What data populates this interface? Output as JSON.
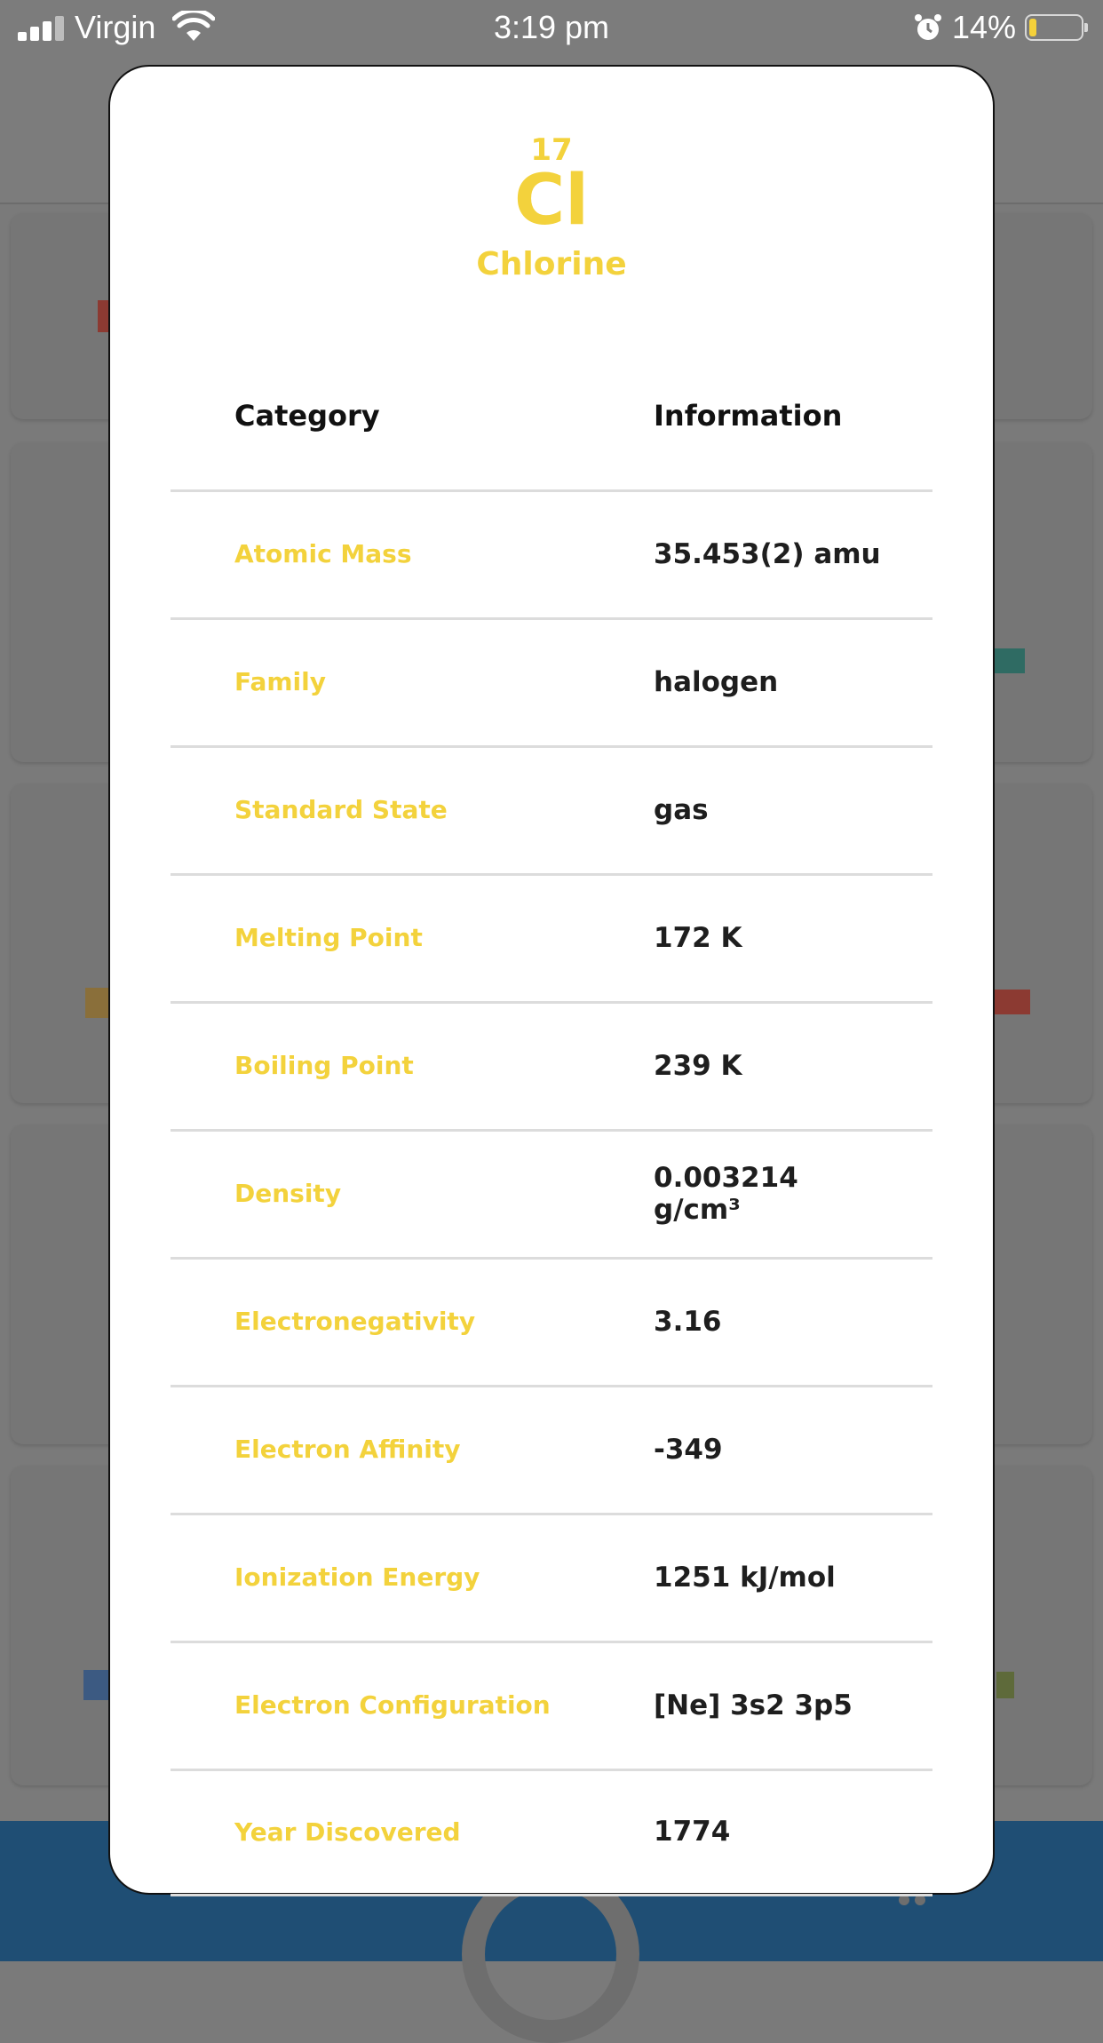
{
  "status_bar": {
    "carrier": "Virgin",
    "time": "3:19 pm",
    "battery_percent": "14%",
    "battery_level": 0.14,
    "icons": [
      "signal-icon",
      "wifi-icon",
      "alarm-icon",
      "battery-icon"
    ]
  },
  "element": {
    "number": "17",
    "symbol": "Cl",
    "name": "Chlorine"
  },
  "table": {
    "headers": {
      "category": "Category",
      "information": "Information"
    },
    "rows": [
      {
        "category": "Atomic Mass",
        "value": "35.453(2) amu"
      },
      {
        "category": "Family",
        "value": "halogen"
      },
      {
        "category": "Standard State",
        "value": "gas"
      },
      {
        "category": "Melting Point",
        "value": "172 K"
      },
      {
        "category": "Boiling Point",
        "value": "239 K"
      },
      {
        "category": "Density",
        "value": "0.003214 g/cm³"
      },
      {
        "category": "Electronegativity",
        "value": "3.16"
      },
      {
        "category": "Electron Affinity",
        "value": "-349"
      },
      {
        "category": "Ionization Energy",
        "value": "1251 kJ/mol"
      },
      {
        "category": "Electron Configuration",
        "value": "[Ne] 3s2 3p5"
      },
      {
        "category": "Year Discovered",
        "value": "1774"
      }
    ]
  },
  "colors": {
    "accent_yellow": "#f3d23c",
    "bottom_bar": "#1f4e74",
    "overlay_bg": "#7a7a7a"
  }
}
